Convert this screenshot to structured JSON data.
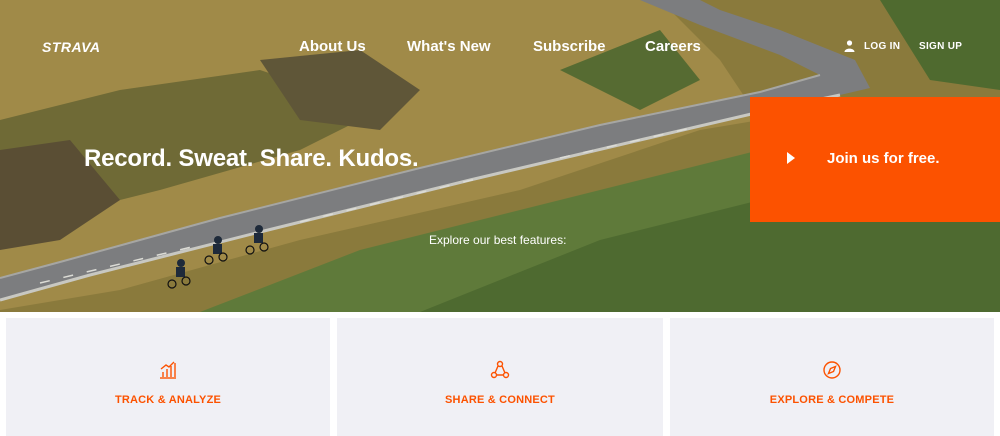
{
  "header": {
    "logo": "STRAVA",
    "nav": [
      {
        "label": "About Us"
      },
      {
        "label": "What's New"
      },
      {
        "label": "Subscribe"
      },
      {
        "label": "Careers"
      }
    ],
    "login_label": "LOG IN",
    "signup_label": "SIGN UP",
    "login_icon": "user-icon"
  },
  "hero": {
    "tagline": "Record. Sweat. Share. Kudos.",
    "join_label": "Join us for free.",
    "join_icon": "play-icon",
    "explore_text": "Explore our best features:"
  },
  "features": [
    {
      "label": "TRACK & ANALYZE",
      "icon": "bar-chart-icon"
    },
    {
      "label": "SHARE & CONNECT",
      "icon": "share-nodes-icon"
    },
    {
      "label": "EXPLORE & COMPETE",
      "icon": "compass-icon"
    }
  ],
  "colors": {
    "brand_orange": "#fc5200",
    "card_bg": "#f0f0f5",
    "text_white": "#ffffff"
  }
}
